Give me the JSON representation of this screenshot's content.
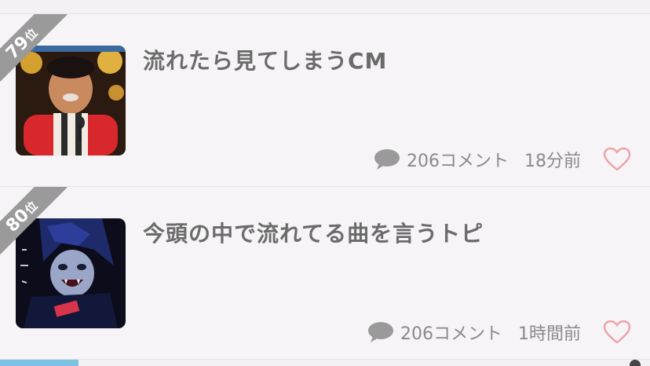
{
  "items": [
    {
      "rank": "79",
      "rank_suffix": "位",
      "title": "流れたら見てしまうCM",
      "comments": "206コメント",
      "time": "18分前",
      "thumb_icon": "person-photo-thumbnail"
    },
    {
      "rank": "80",
      "rank_suffix": "位",
      "title": "今頭の中で流れてる曲を言うトピ",
      "comments": "206コメント",
      "time": "1時間前",
      "thumb_icon": "illustration-thumbnail"
    }
  ],
  "colors": {
    "ribbon": "#9a9a9a",
    "title": "#6b6b6b",
    "meta": "#8a8a8a",
    "heart": "#f0a0a8",
    "bubble": "#9a9a9a"
  }
}
